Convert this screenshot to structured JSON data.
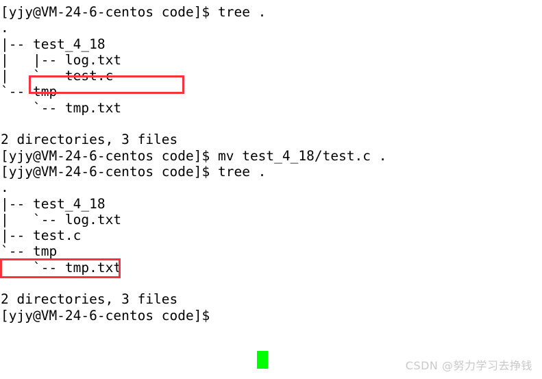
{
  "terminal": {
    "background_color": "#ffffff",
    "foreground_color": "#000000",
    "cursor_color": "#00ff00",
    "highlight_color": "#f4333c",
    "prompt": "[yjy@VM-24-6-centos code]$",
    "lines": [
      {
        "id": "l1",
        "text": "[yjy@VM-24-6-centos code]$ tree ."
      },
      {
        "id": "l2",
        "text": "."
      },
      {
        "id": "l3",
        "text": "|-- test_4_18"
      },
      {
        "id": "l4",
        "text": "|   |-- log.txt"
      },
      {
        "id": "l5",
        "text": "|   `-- test.c"
      },
      {
        "id": "l6",
        "text": "`-- tmp"
      },
      {
        "id": "l7",
        "text": "    `-- tmp.txt"
      },
      {
        "id": "l8",
        "text": ""
      },
      {
        "id": "l9",
        "text": "2 directories, 3 files"
      },
      {
        "id": "l10",
        "text": "[yjy@VM-24-6-centos code]$ mv test_4_18/test.c ."
      },
      {
        "id": "l11",
        "text": "[yjy@VM-24-6-centos code]$ tree ."
      },
      {
        "id": "l12",
        "text": "."
      },
      {
        "id": "l13",
        "text": "|-- test_4_18"
      },
      {
        "id": "l14",
        "text": "|   `-- log.txt"
      },
      {
        "id": "l15",
        "text": "|-- test.c"
      },
      {
        "id": "l16",
        "text": "`-- tmp"
      },
      {
        "id": "l17",
        "text": "    `-- tmp.txt"
      },
      {
        "id": "l18",
        "text": ""
      },
      {
        "id": "l19",
        "text": "2 directories, 3 files"
      },
      {
        "id": "l20",
        "text": "[yjy@VM-24-6-centos code]$"
      }
    ],
    "commands": [
      "tree .",
      "mv test_4_18/test.c .",
      "tree ."
    ],
    "summaries": [
      "2 directories, 3 files",
      "2 directories, 3 files"
    ],
    "highlights": [
      {
        "id": "hl1",
        "label": "`-- test.c"
      },
      {
        "id": "hl2",
        "label": "|-- test.c"
      }
    ]
  },
  "watermark": {
    "text": "CSDN @努力学习去挣钱"
  }
}
